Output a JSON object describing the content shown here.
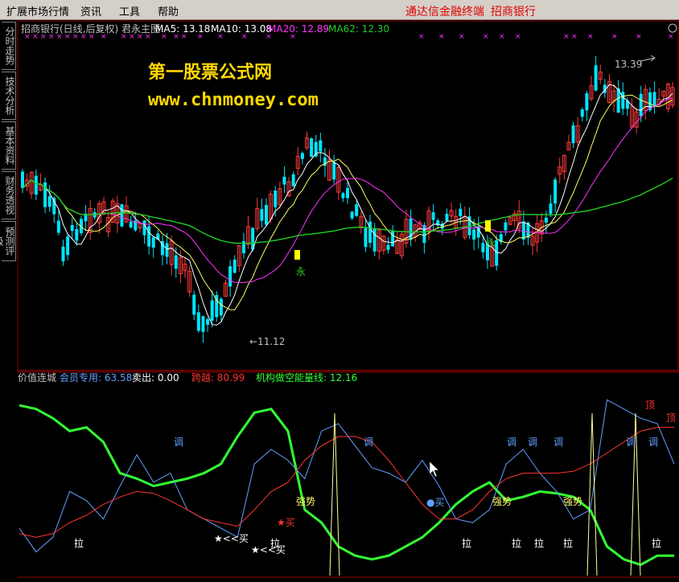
{
  "menu": {
    "items": [
      "扩展市场行情",
      "资讯",
      "工具",
      "帮助"
    ],
    "right_links": [
      "通达信金融终端",
      "招商银行"
    ]
  },
  "side_tabs": [
    "分时走势",
    "技术分析",
    "基本资料",
    "财务透视",
    "预测评级"
  ],
  "watermark": {
    "line1": "第一股票公式网",
    "line2": "www.chnmoney.com"
  },
  "colors": {
    "up": "#ff3b3b",
    "down": "#00e5ff",
    "ma5": "#ffffff",
    "ma10": "#ffff66",
    "ma20": "#ff33ff",
    "ma62": "#22cc22",
    "grid": "#8b0000",
    "menu_bg": "#d4d0c8"
  },
  "chart_data": [
    {
      "type": "candlestick",
      "title": "招商银行(日线,后复权) 君永主图",
      "legend": [
        {
          "name": "MA5",
          "value": "13.18",
          "color": "#ffffff"
        },
        {
          "name": "MA10",
          "value": "13.08",
          "color": "#ffffff"
        },
        {
          "name": "MA20",
          "value": "12.89",
          "color": "#ff33ff"
        },
        {
          "name": "MA62",
          "value": "12.30",
          "color": "#22cc22"
        }
      ],
      "annotations": [
        {
          "text": "13.39",
          "kind": "high"
        },
        {
          "text": "←11.12",
          "kind": "low"
        },
        {
          "text": "永",
          "kind": "signal"
        },
        {
          "text": "永",
          "kind": "signal"
        }
      ],
      "grid": true
    },
    {
      "type": "line",
      "title": "价值连城",
      "legend": [
        {
          "name": "会员专用",
          "value": "63.58",
          "color": "#5fa0ff"
        },
        {
          "name": "卖出",
          "value": "0.00",
          "color": "#ffffff"
        },
        {
          "name": "跨越",
          "value": "80.99",
          "color": "#ff3333"
        },
        {
          "name": "机构做空能量线",
          "value": "12.16",
          "color": "#33ff33"
        }
      ],
      "labels": [
        "调",
        "调",
        "调",
        "调",
        "调",
        "调",
        "调",
        "强势",
        "强势",
        "强势",
        "拉",
        "拉",
        "拉",
        "拉",
        "拉",
        "拉",
        "拉",
        "★<<买",
        "★<<买",
        "★买",
        "●买",
        "顶",
        "顶"
      ],
      "series": [
        {
          "name": "机构做空能量线",
          "color": "#33ff33",
          "values": [
            92,
            90,
            85,
            78,
            80,
            72,
            55,
            52,
            48,
            50,
            52,
            55,
            60,
            75,
            88,
            90,
            78,
            35,
            28,
            15,
            10,
            8,
            10,
            15,
            20,
            28,
            38,
            45,
            50,
            40,
            42,
            45,
            44,
            42,
            35,
            15,
            8,
            5,
            10,
            10
          ]
        },
        {
          "name": "会员专用",
          "color": "#5fa0ff",
          "values": [
            25,
            12,
            20,
            45,
            40,
            30,
            48,
            65,
            50,
            55,
            35,
            30,
            25,
            20,
            60,
            68,
            62,
            52,
            78,
            82,
            70,
            58,
            55,
            50,
            62,
            48,
            30,
            28,
            35,
            60,
            68,
            55,
            45,
            30,
            35,
            95,
            90,
            85,
            82,
            60
          ]
        },
        {
          "name": "跨越",
          "color": "#ff3333",
          "values": [
            22,
            20,
            22,
            28,
            32,
            38,
            42,
            45,
            44,
            40,
            35,
            30,
            28,
            26,
            35,
            45,
            50,
            62,
            70,
            75,
            75,
            72,
            62,
            50,
            38,
            30,
            30,
            35,
            45,
            52,
            55,
            55,
            55,
            56,
            60,
            66,
            72,
            78,
            80,
            80
          ]
        }
      ]
    }
  ]
}
